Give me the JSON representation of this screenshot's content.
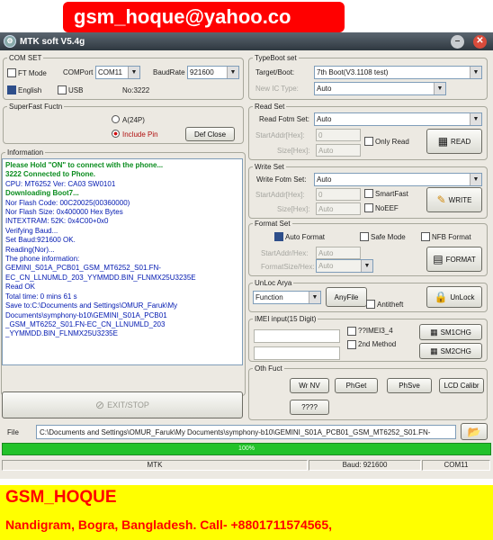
{
  "banner": {
    "email": "gsm_hoque@yahoo.co"
  },
  "window": {
    "title": "MTK soft V5.4g"
  },
  "com_set": {
    "legend": "COM SET",
    "ft_mode_label": "FT Mode",
    "com_port_label": "COMPort",
    "com_port_value": "COM11",
    "baud_rate_label": "BaudRate",
    "baud_rate_value": "921600",
    "english_label": "English",
    "usb_label": "USB",
    "no_label": "No:3222"
  },
  "superfast": {
    "legend": "SuperFast Fuctn",
    "option_a": "A(24P)",
    "option_b": "Include Pin",
    "default_button": "Def Close"
  },
  "information": {
    "legend": "Information",
    "log": [
      {
        "text": "Please Hold \"ON\" to connect with the phone...",
        "style": "g"
      },
      {
        "text": "3222 Connected to Phone.",
        "style": "g"
      },
      {
        "text": "CPU: MT6252 Ver: CA03  SW0101",
        "style": "n"
      },
      {
        "text": "Downloading Boot7...",
        "style": "g"
      },
      {
        "text": "Nor Flash Code: 00C20025(00360000)",
        "style": "n"
      },
      {
        "text": "Nor Flash Size: 0x400000 Hex Bytes",
        "style": "n"
      },
      {
        "text": "INTEXTRAM: 52K: 0x4C00+0x0",
        "style": "n"
      },
      {
        "text": "Verifying Baud...",
        "style": "n"
      },
      {
        "text": "Set Baud:921600 OK.",
        "style": "n"
      },
      {
        "text": "Reading(Nor)...",
        "style": "n"
      },
      {
        "text": "The phone information:",
        "style": "n"
      },
      {
        "text": "GEMINI_S01A_PCB01_GSM_MT6252_S01.FN-",
        "style": "n"
      },
      {
        "text": "EC_CN_LLNUMLD_203_YYMMDD.BIN_FLNMX25U3235E",
        "style": "n"
      },
      {
        "text": "Read OK",
        "style": "n"
      },
      {
        "text": "Total time: 0 mins 61 s",
        "style": "n"
      },
      {
        "text": "Save to:C:\\Documents and Settings\\OMUR_Faruk\\My",
        "style": "n"
      },
      {
        "text": "Documents\\symphony-b10\\GEMINI_S01A_PCB01",
        "style": "n"
      },
      {
        "text": "_GSM_MT6252_S01.FN-EC_CN_LLNUMLD_203",
        "style": "n"
      },
      {
        "text": "_YYMMDD.BIN_FLNMX25U3235E",
        "style": "n"
      }
    ]
  },
  "exit_button": "EXIT/STOP",
  "typeboot": {
    "legend": "TypeBoot set",
    "target_label": "Target/Boot:",
    "target_value": "7th Boot(V3.1108 test)",
    "new_ic_label": "New IC Type:",
    "new_ic_value": "Auto"
  },
  "read_set": {
    "legend": "Read Set",
    "format_label": "Read Fotm Set:",
    "format_value": "Auto",
    "start_label": "StartAddr[Hex]:",
    "start_value": "0",
    "size_label": "Size[Hex]:",
    "size_value": "Auto",
    "only_read_label": "Only Read",
    "read_button": "READ"
  },
  "write_set": {
    "legend": "Write Set",
    "format_label": "Write Fotm Set:",
    "format_value": "Auto",
    "start_label": "StartAddr[Hex]:",
    "start_value": "0",
    "size_label": "Size[Hex]:",
    "size_value": "Auto",
    "smart_fast_label": "SmartFast",
    "no_eef_label": "NoEEF",
    "write_button": "WRITE"
  },
  "format_set": {
    "legend": "Format Set",
    "auto_label": "Auto Format",
    "safe_label": "Safe Mode",
    "nfb_label": "NFB Format",
    "start_label": "StartAddr/Hex:",
    "start_value": "Auto",
    "format_size_label": "FormatSize/Hex:",
    "format_size_value": "Auto",
    "format_button": "FORMAT"
  },
  "unlock": {
    "legend": "UnLoc Arya",
    "function_value": "Function",
    "anyfile_button": "AnyFile",
    "anti_theft_label": "Antitheft",
    "unlock_button": "UnLock"
  },
  "imei": {
    "legend": "IMEI input(15 Digit)",
    "imei4_label": "??IMEI3_4",
    "second_method_label": "2nd Method",
    "sim1_button": "SM1CHG",
    "sim2_button": "SM2CHG"
  },
  "other": {
    "legend": "Oth Fuct",
    "wr_nv_button": "Wr NV",
    "ph_get_button": "PhGet",
    "ph_save_button": "PhSve",
    "lcd_button": "LCD Calibr",
    "q_button": "????"
  },
  "file": {
    "label": "File",
    "path": "C:\\Documents and Settings\\OMUR_Faruk\\My Documents\\symphony-b10\\GEMINI_S01A_PCB01_GSM_MT6252_S01.FN-"
  },
  "progress": {
    "percent": 100,
    "label": "100%"
  },
  "status": {
    "mode": "MTK",
    "baud": "Baud: 921600",
    "port": "COM11"
  },
  "footer": {
    "name": "GSM_HOQUE",
    "contact": "Nandigram, Bogra, Bangladesh. Call- +8801711574565,"
  },
  "colors": {
    "banner_bg": "#ff0000",
    "footer_bg": "#ffff00",
    "progress": "#22c22a",
    "log_status": "#0a8c1e",
    "log_info": "#0018b0"
  }
}
